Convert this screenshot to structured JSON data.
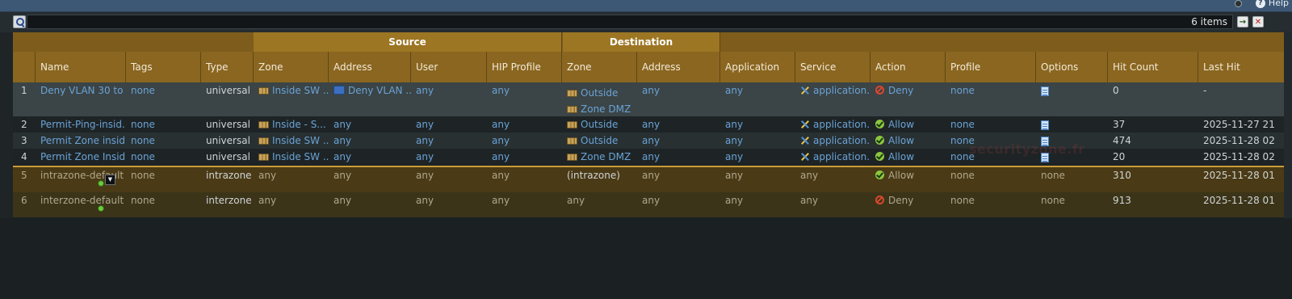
{
  "header": {
    "help_label": "Help"
  },
  "search": {
    "placeholder": "",
    "value": "",
    "item_count": "6 items"
  },
  "table": {
    "group_headers": {
      "source": "Source",
      "destination": "Destination"
    },
    "columns": [
      "Name",
      "Tags",
      "Type",
      "Zone",
      "Address",
      "User",
      "HIP Profile",
      "Zone",
      "Address",
      "Application",
      "Service",
      "Action",
      "Profile",
      "Options",
      "Hit Count",
      "Last Hit"
    ],
    "rows": [
      {
        "index": "1",
        "name": "Deny VLAN 30 to ...",
        "tags": "none",
        "type": "universal",
        "src_zone": "Inside SW ...",
        "src_address": "Deny VLAN ...",
        "user": "any",
        "hip": "any",
        "dst_zone": [
          "Outside",
          "Zone DMZ"
        ],
        "dst_address": "any",
        "application": "any",
        "service": "application...",
        "action": "Deny",
        "profile": "none",
        "options": "doc",
        "hit_count": "0",
        "last_hit": "-"
      },
      {
        "index": "2",
        "name": "Permit-Ping-insid...",
        "tags": "none",
        "type": "universal",
        "src_zone": "Inside - S...",
        "src_address": "any",
        "user": "any",
        "hip": "any",
        "dst_zone": [
          "Outside"
        ],
        "dst_address": "any",
        "application": "any",
        "service": "application...",
        "action": "Allow",
        "profile": "none",
        "options": "doc",
        "hit_count": "37",
        "last_hit": "2025-11-27 21"
      },
      {
        "index": "3",
        "name": "Permit Zone insid...",
        "tags": "none",
        "type": "universal",
        "src_zone": "Inside SW ...",
        "src_address": "any",
        "user": "any",
        "hip": "any",
        "dst_zone": [
          "Outside"
        ],
        "dst_address": "any",
        "application": "any",
        "service": "application...",
        "action": "Allow",
        "profile": "none",
        "options": "doc",
        "hit_count": "474",
        "last_hit": "2025-11-28 02"
      },
      {
        "index": "4",
        "name": "Permit Zone Insid...",
        "tags": "none",
        "type": "universal",
        "src_zone": "Inside SW ...",
        "src_address": "any",
        "user": "any",
        "hip": "any",
        "dst_zone": [
          "Zone DMZ"
        ],
        "dst_address": "any",
        "application": "any",
        "service": "application...",
        "action": "Allow",
        "profile": "none",
        "options": "doc",
        "hit_count": "20",
        "last_hit": "2025-11-28 02"
      },
      {
        "index": "5",
        "name": "intrazone-default",
        "tags": "none",
        "type": "intrazone",
        "src_zone": "any",
        "src_address": "any",
        "user": "any",
        "hip": "any",
        "dst_zone": [
          "(intrazone)"
        ],
        "dst_address": "any",
        "application": "any",
        "service": "any",
        "action": "Allow",
        "profile": "none",
        "options": "none",
        "hit_count": "310",
        "last_hit": "2025-11-28 01"
      },
      {
        "index": "6",
        "name": "interzone-default",
        "tags": "none",
        "type": "interzone",
        "src_zone": "any",
        "src_address": "any",
        "user": "any",
        "hip": "any",
        "dst_zone": [
          "any"
        ],
        "dst_address": "any",
        "application": "any",
        "service": "any",
        "action": "Deny",
        "profile": "none",
        "options": "none",
        "hit_count": "913",
        "last_hit": "2025-11-28 01"
      }
    ]
  },
  "watermark": "securityzone.fr",
  "colors": {
    "header_gold": "#8a6620",
    "link_blue": "#6aa3d6",
    "deny_red": "#d9472f",
    "allow_green": "#8cc63f"
  }
}
